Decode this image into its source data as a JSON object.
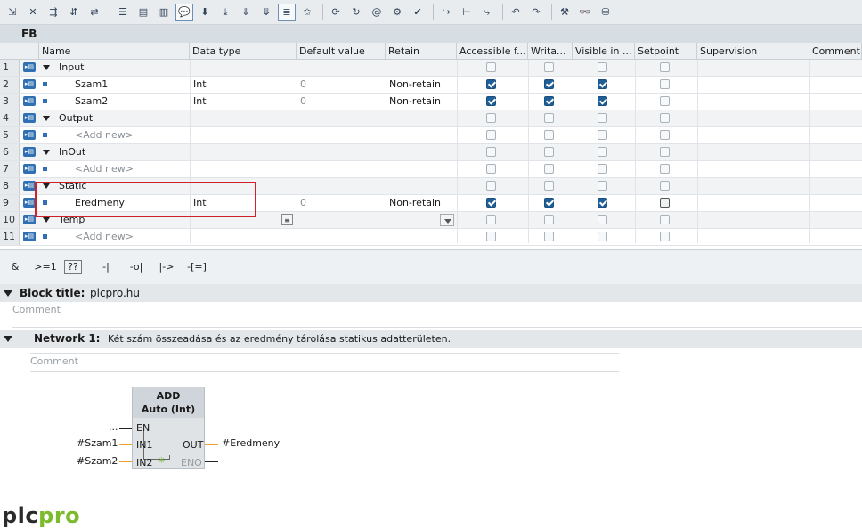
{
  "block_name": "FB",
  "table": {
    "headers": [
      "Name",
      "Data type",
      "Default value",
      "Retain",
      "Accessible f...",
      "Writa...",
      "Visible in ...",
      "Setpoint",
      "Supervision",
      "Comment"
    ],
    "rows": [
      {
        "num": "1",
        "name": "Input",
        "section": true,
        "type": "",
        "default": "",
        "retain": "",
        "acc": false,
        "wr": false,
        "vis": false,
        "sp": false
      },
      {
        "num": "2",
        "name": "Szam1",
        "section": false,
        "type": "Int",
        "default": "0",
        "retain": "Non-retain",
        "acc": true,
        "wr": true,
        "vis": true,
        "sp": false
      },
      {
        "num": "3",
        "name": "Szam2",
        "section": false,
        "type": "Int",
        "default": "0",
        "retain": "Non-retain",
        "acc": true,
        "wr": true,
        "vis": true,
        "sp": false
      },
      {
        "num": "4",
        "name": "Output",
        "section": true,
        "type": "",
        "default": "",
        "retain": "",
        "acc": false,
        "wr": false,
        "vis": false,
        "sp": false
      },
      {
        "num": "5",
        "name": "<Add new>",
        "section": false,
        "addnew": true,
        "type": "",
        "default": "",
        "retain": "",
        "acc": false,
        "wr": false,
        "vis": false,
        "sp": false
      },
      {
        "num": "6",
        "name": "InOut",
        "section": true,
        "type": "",
        "default": "",
        "retain": "",
        "acc": false,
        "wr": false,
        "vis": false,
        "sp": false
      },
      {
        "num": "7",
        "name": "<Add new>",
        "section": false,
        "addnew": true,
        "type": "",
        "default": "",
        "retain": "",
        "acc": false,
        "wr": false,
        "vis": false,
        "sp": false
      },
      {
        "num": "8",
        "name": "Static",
        "section": true,
        "type": "",
        "default": "",
        "retain": "",
        "acc": false,
        "wr": false,
        "vis": false,
        "sp": false
      },
      {
        "num": "9",
        "name": "Eredmeny",
        "section": false,
        "type": "Int",
        "default": "0",
        "retain": "Non-retain",
        "acc": true,
        "wr": true,
        "vis": true,
        "sp": false
      },
      {
        "num": "10",
        "name": "Temp",
        "section": true,
        "type": "",
        "default": "",
        "retain": "",
        "acc": false,
        "wr": false,
        "vis": false,
        "sp": false
      },
      {
        "num": "11",
        "name": "<Add new>",
        "section": false,
        "addnew": true,
        "type": "",
        "default": "",
        "retain": "",
        "acc": false,
        "wr": false,
        "vis": false,
        "sp": false
      }
    ]
  },
  "instruction_bar": [
    "&",
    ">=1",
    "??",
    "-|",
    "-o|",
    "|->",
    "-[=]"
  ],
  "block_title": {
    "label": "Block title:",
    "value": "plcpro.hu",
    "comment": "Comment"
  },
  "network": {
    "label": "Network 1:",
    "title": "Két szám összeadása és az eredmény tárolása statikus adatterületen.",
    "comment": "Comment"
  },
  "add_block": {
    "name": "ADD",
    "type": "Auto (Int)",
    "pins": {
      "en": "EN",
      "in1": "IN1",
      "in2": "IN2",
      "out": "OUT",
      "eno": "ENO"
    },
    "en_source": "...",
    "in1_operand": "#Szam1",
    "in2_operand": "#Szam2",
    "out_operand": "#Eredmeny"
  },
  "logo": {
    "part1": "plc",
    "part2": "pro",
    "color1": "#2b2b2b",
    "color2": "#7cbb2b"
  },
  "colors": {
    "accent": "#2f6fb2",
    "wire": "#f0a030",
    "highlight": "#d0202a"
  }
}
